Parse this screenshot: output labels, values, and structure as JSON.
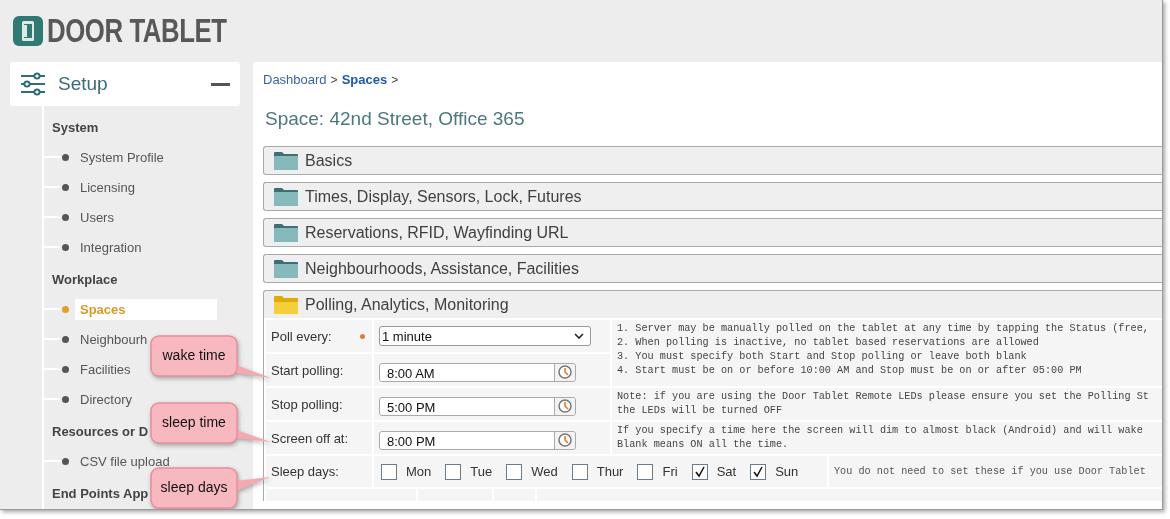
{
  "logo": {
    "text": "DOOR TABLET"
  },
  "sidebar": {
    "title": "Setup",
    "expanded": true,
    "groups": [
      {
        "heading": "System",
        "items": [
          {
            "label": "System Profile",
            "selected": false
          },
          {
            "label": "Licensing",
            "selected": false
          },
          {
            "label": "Users",
            "selected": false
          },
          {
            "label": "Integration",
            "selected": false
          }
        ]
      },
      {
        "heading": "Workplace",
        "items": [
          {
            "label": "Spaces",
            "selected": true
          },
          {
            "label": "Neighbourh",
            "selected": false
          },
          {
            "label": "Facilities",
            "selected": false
          },
          {
            "label": "Directory",
            "selected": false
          }
        ]
      },
      {
        "heading": "Resources or D",
        "items": [
          {
            "label": "CSV file upload",
            "selected": false
          }
        ]
      },
      {
        "heading": "End Points App"
      }
    ]
  },
  "breadcrumb": {
    "separator": ">",
    "items": [
      {
        "label": "Dashboard",
        "current": false
      },
      {
        "label": "Spaces",
        "current": true
      }
    ]
  },
  "title": "Space: 42nd Street, Office 365",
  "sections": [
    {
      "title": "Basics",
      "expanded": false
    },
    {
      "title": "Times, Display, Sensors, Lock, Futures",
      "expanded": false
    },
    {
      "title": "Reservations, RFID, Wayfinding URL",
      "expanded": false
    },
    {
      "title": "Neighbourhoods, Assistance, Facilities",
      "expanded": false
    },
    {
      "title": "Polling, Analytics, Monitoring",
      "expanded": true
    }
  ],
  "polling_form": {
    "fields": [
      {
        "kind": "select",
        "label": "Poll every:",
        "required": true,
        "value": "1 minute"
      },
      {
        "kind": "time",
        "label": "Start polling:",
        "required": false,
        "value": "8:00 AM"
      },
      {
        "kind": "time",
        "label": "Stop polling:",
        "required": false,
        "value": "5:00 PM"
      },
      {
        "kind": "time",
        "label": "Screen off at:",
        "required": false,
        "value": "8:00 PM"
      }
    ],
    "polling_notes": [
      "1. Server may be manually polled on the tablet at any time by tapping the Status (free,",
      "2. When polling is inactive, no tablet based reservations are allowed",
      "3. You must specify both Start and Stop polling or leave both blank",
      "4. Start must be on or before 10:00 AM and Stop must be on or after 05:00 PM"
    ],
    "led_note": [
      "Note: if you are using the Door Tablet Remote LEDs please ensure you set the Polling St",
      "the LEDs will be turned OFF"
    ],
    "screen_note": [
      "If you specify a time here the screen will dim to almost black (Android) and will wake",
      "Blank means ON all the time."
    ],
    "sleep_days": {
      "label": "Sleep days:",
      "days": [
        {
          "label": "Mon",
          "checked": false
        },
        {
          "label": "Tue",
          "checked": false
        },
        {
          "label": "Wed",
          "checked": false
        },
        {
          "label": "Thur",
          "checked": false
        },
        {
          "label": "Fri",
          "checked": false
        },
        {
          "label": "Sat",
          "checked": true
        },
        {
          "label": "Sun",
          "checked": true
        }
      ],
      "note": "You do not need to set these if you use Door Tablet"
    }
  },
  "callouts": [
    {
      "text": "wake time"
    },
    {
      "text": "sleep time"
    },
    {
      "text": "sleep days"
    }
  ]
}
